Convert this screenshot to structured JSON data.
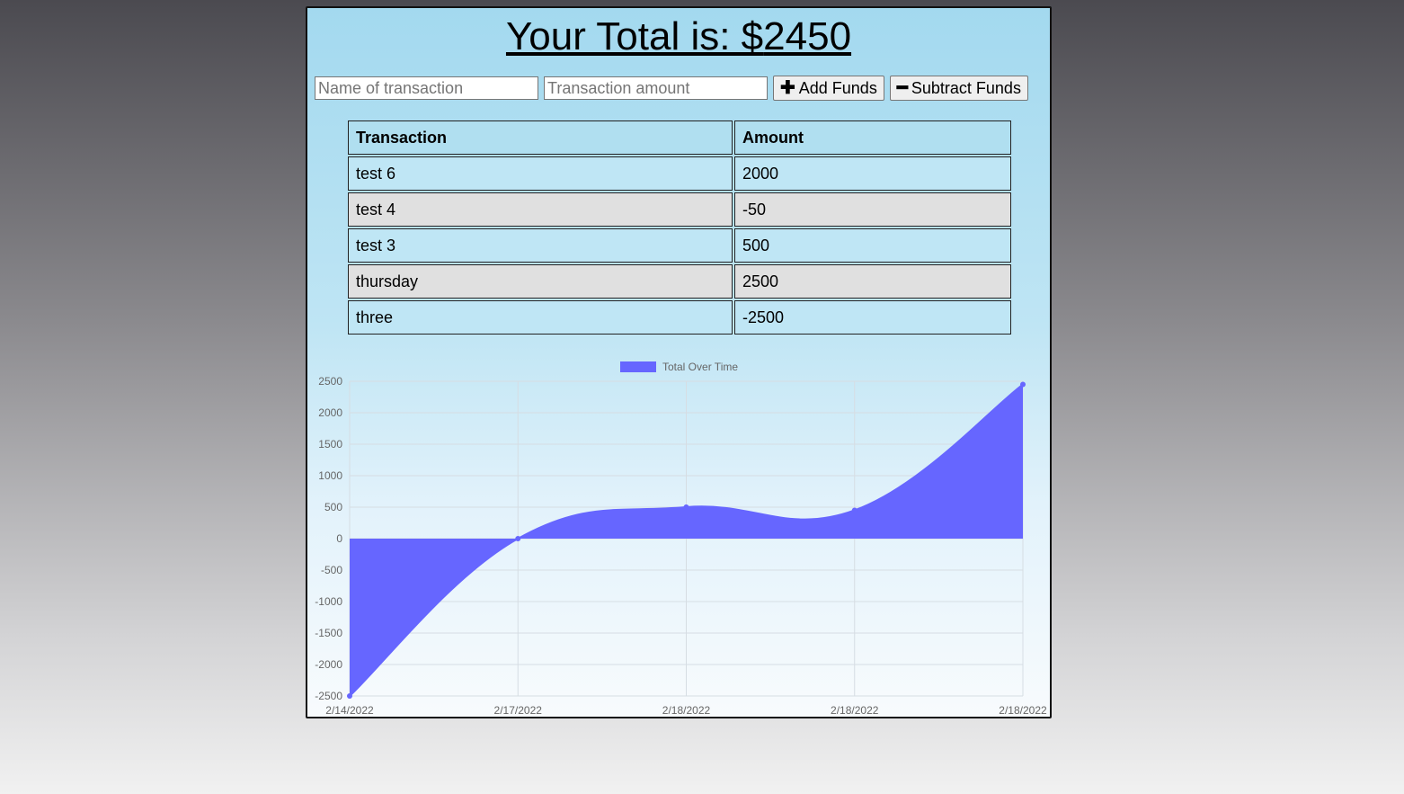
{
  "header": {
    "total_prefix": "Your Total is: $",
    "total_value": "2450"
  },
  "form": {
    "name_placeholder": "Name of transaction",
    "amount_placeholder": "Transaction amount",
    "add_label": "Add Funds",
    "add_icon": "plus-icon",
    "subtract_label": "Subtract Funds",
    "subtract_icon": "minus-icon"
  },
  "table": {
    "headers": [
      "Transaction",
      "Amount"
    ],
    "rows": [
      {
        "name": "test 6",
        "amount": "2000"
      },
      {
        "name": "test 4",
        "amount": "-50"
      },
      {
        "name": "test 3",
        "amount": "500"
      },
      {
        "name": "thursday",
        "amount": "2500"
      },
      {
        "name": "three",
        "amount": "-2500"
      }
    ]
  },
  "colors": {
    "series_fill": "#6666ff",
    "series_line": "#6666ff",
    "grid": "#d6dde3"
  },
  "chart_data": {
    "type": "area",
    "legend": "Total Over Time",
    "legend_position": "top",
    "categories": [
      "2/14/2022",
      "2/17/2022",
      "2/18/2022",
      "2/18/2022",
      "2/18/2022"
    ],
    "series": [
      {
        "name": "Total Over Time",
        "values": [
          -2500,
          0,
          500,
          450,
          2450
        ]
      }
    ],
    "y_ticks": [
      2500,
      2000,
      1500,
      1000,
      500,
      0,
      -500,
      -1000,
      -1500,
      -2000,
      -2500
    ],
    "ylim": [
      -2500,
      2500
    ],
    "grid": true
  }
}
